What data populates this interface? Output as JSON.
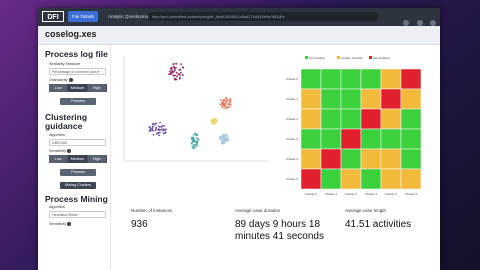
{
  "browser": {
    "logo": "DFI",
    "tabs": [
      {
        "label": "File Details"
      },
      {
        "label": "Analytic Questionnaire"
      }
    ],
    "url": "http://pm-controlled-sobscripting/fd_field/1004001c8dd27b4444b0e0f81d0c"
  },
  "header": {
    "file_title": "coselog.xes"
  },
  "sidebar": {
    "process_log": {
      "title": "Process log file",
      "similarity_label": "Similarity Measure",
      "similarity_value": "Percentage of common acts ▾",
      "granularity_label": "Granularity",
      "granularity_options": [
        "Low",
        "Medium",
        "High"
      ],
      "process_button": "Process"
    },
    "clustering": {
      "title": "Clustering guidance",
      "algorithm_label": "Algorithm",
      "algorithm_value": "DBSCAN",
      "sensitivity_label": "Sensitivity",
      "sensitivity_options": [
        "Low",
        "Medium",
        "High"
      ],
      "process_button": "Process",
      "mining_button": "Mining Clusters"
    },
    "mining": {
      "title": "Process Mining",
      "algorithm_label": "Algorithm",
      "algorithm_value": "Heuristics Miner",
      "sensitivity_label": "Sensitivity"
    }
  },
  "heatmap": {
    "legend": [
      "low similarity",
      "medium similarity",
      "high similarity"
    ],
    "rows": [
      "Cluster 0",
      "Cluster 1",
      "Cluster 2",
      "Cluster 3",
      "Cluster 4",
      "Cluster 5"
    ],
    "cols": [
      "Cluster 0",
      "Cluster 1",
      "Cluster 2",
      "Cluster 3",
      "Cluster 4",
      "Cluster 5"
    ],
    "colors": {
      "low": "#3cd13c",
      "medium": "#f2b93b",
      "high": "#e0202c"
    },
    "grid": [
      [
        "low",
        "low",
        "low",
        "low",
        "medium",
        "high"
      ],
      [
        "medium",
        "low",
        "low",
        "medium",
        "high",
        "medium"
      ],
      [
        "medium",
        "low",
        "low",
        "high",
        "medium",
        "low"
      ],
      [
        "low",
        "low",
        "high",
        "low",
        "low",
        "low"
      ],
      [
        "medium",
        "high",
        "low",
        "medium",
        "medium",
        "low"
      ],
      [
        "high",
        "low",
        "medium",
        "low",
        "medium",
        "medium"
      ]
    ]
  },
  "scatter_colors": [
    "#8b2a62",
    "#6a4a9c",
    "#e07a5f",
    "#4aa6a0",
    "#e6d86a",
    "#a8c8e0"
  ],
  "stats": [
    {
      "label": "Number of instances",
      "value": "936"
    },
    {
      "label": "Average case duration",
      "value": "89 days 9 hours 18 minutes 41 seconds"
    },
    {
      "label": "Average case length",
      "value": "41.51 activities"
    }
  ],
  "cursor_label": "Cluster 0"
}
